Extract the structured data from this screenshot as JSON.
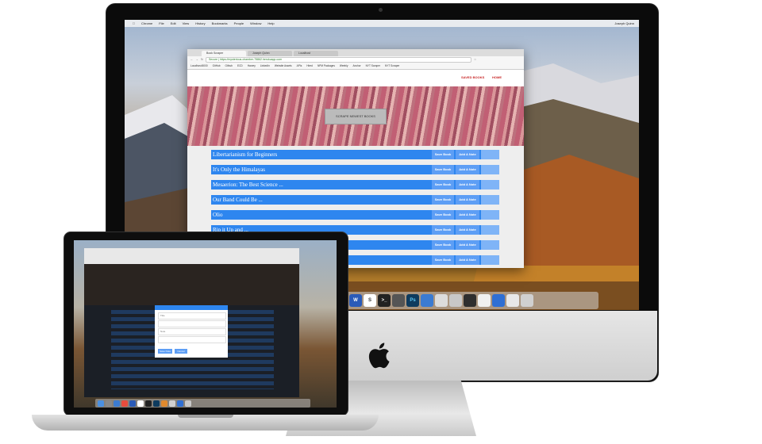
{
  "imac": {
    "menubar": {
      "items": [
        "Chrome",
        "File",
        "Edit",
        "View",
        "History",
        "Bookmarks",
        "People",
        "Window",
        "Help"
      ],
      "status": "Joseph Quinn"
    },
    "browser": {
      "tabs": [
        "Book Scraper",
        "Joseph Quinn",
        "Localhost"
      ],
      "url": "Secure | https://mysterious-chamber-75862.herokuapp.com",
      "bookmarks": [
        "Localhost:8000",
        "GitHub",
        "Github",
        "ECD",
        "Harvey",
        "LinkedIn",
        "Website Assets",
        "APIs",
        "Hired",
        "NPM Packages",
        "Weebly",
        "Anchor",
        "NYT Scraper",
        "NYT Scraper"
      ],
      "nav": {
        "saved_books": "SAVED BOOKS",
        "home": "HOME"
      },
      "scrape_button": "SCRAPE NEWEST BOOKS",
      "save_label": "Save Book",
      "note_label": "Add A Note",
      "books": [
        "Libertarianism for Beginners",
        "It's Only the Himalayas",
        "Mesaerion: The Best Science ...",
        "Our Band Could Be ...",
        "Olio",
        "Rip it Up and ...",
        "",
        ""
      ]
    },
    "dock_icons": [
      "finder-icon",
      "launchpad-icon",
      "word-icon",
      "slack-icon",
      "terminal-icon",
      "sublime-icon",
      "photoshop-icon",
      "preview-icon",
      "mail-icon",
      "photos-icon",
      "trash-icon"
    ]
  },
  "macbook": {
    "modal": {
      "fields": [
        "Title",
        "",
        "Note",
        ""
      ],
      "save": "Save Note",
      "cancel": "Cancel"
    }
  }
}
